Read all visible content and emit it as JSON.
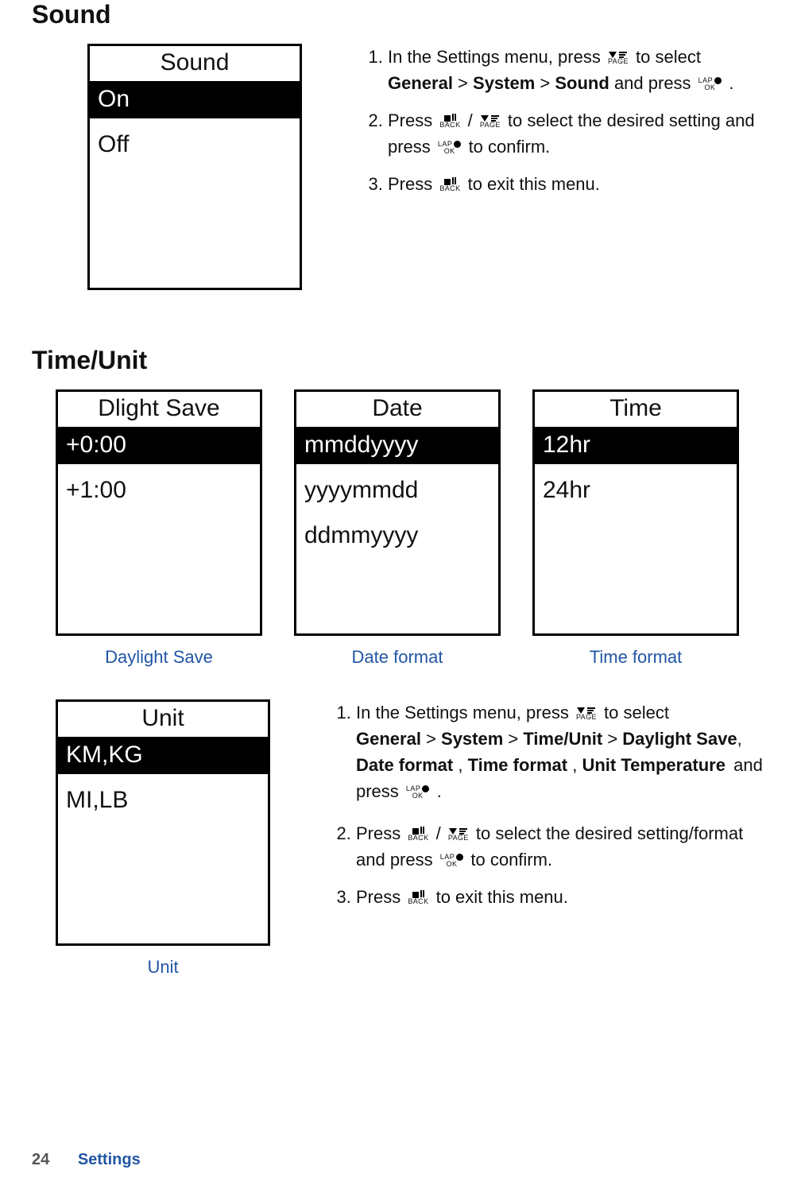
{
  "sound": {
    "heading": "Sound",
    "screen_title": "Sound",
    "options": {
      "on": "On",
      "off": "Off"
    },
    "steps": {
      "s1a": "In the Settings menu, press ",
      "s1b": " to select ",
      "s1_path1": "General",
      "gt": " > ",
      "s1_path2": "System",
      "s1_path3": "Sound",
      "s1c": " and press ",
      "dot": " .",
      "s2a": "Press ",
      "slash": " / ",
      "s2b": " to select the desired setting and press ",
      "s2c": " to confirm.",
      "s3a": "Press ",
      "s3b": " to exit this menu."
    }
  },
  "timeunit": {
    "heading": "Time/Unit",
    "dlight": {
      "title": "Dlight Save",
      "opt1": "+0:00",
      "opt2": "+1:00",
      "caption": "Daylight Save"
    },
    "date": {
      "title": "Date",
      "opt1": "mmddyyyy",
      "opt2": "yyyymmdd",
      "opt3": "ddmmyyyy",
      "caption": "Date format"
    },
    "time": {
      "title": "Time",
      "opt1": "12hr",
      "opt2": "24hr",
      "caption": "Time format"
    },
    "unit": {
      "title": "Unit",
      "opt1": "KM,KG",
      "opt2": "MI,LB",
      "caption": "Unit"
    },
    "steps": {
      "s1a": "In the Settings menu, press ",
      "s1b": " to select",
      "path_general": "General",
      "gt": " > ",
      "path_system": "System",
      "path_timeunit": "Time/Unit",
      "path_daylight": "Daylight Save",
      "comma": ", ",
      "path_dateformat": "Date format",
      "commasp": " , ",
      "path_timeformat": "Time format",
      "path_unit": "Unit",
      "path_temp": "Temperature",
      "andpress": " and press ",
      "dot": ".",
      "s2a": "Press ",
      "slash": " / ",
      "s2b": " to select the desired setting/format and press ",
      "s2c": " to confirm.",
      "s3a": "Press ",
      "s3b": " to exit this menu."
    }
  },
  "btn": {
    "page_bot": "PAGE",
    "back_bot": "BACK",
    "lap_top": "LAP",
    "ok_bot": "OK"
  },
  "footer": {
    "page": "24",
    "section": "Settings"
  }
}
